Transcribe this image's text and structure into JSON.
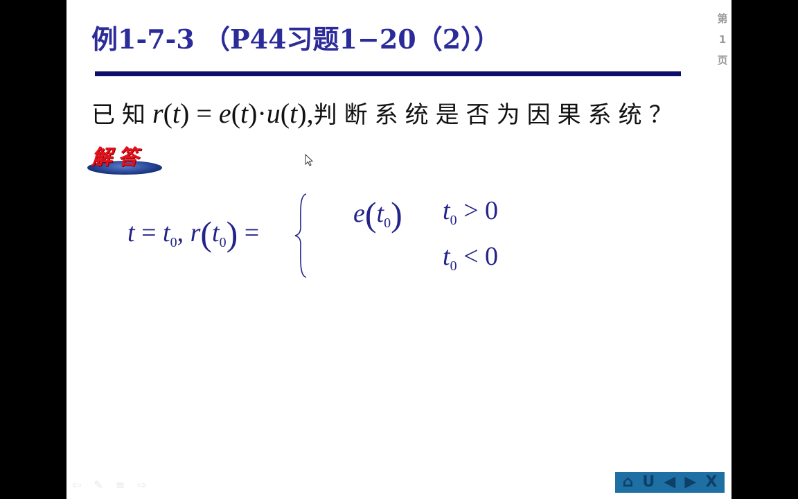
{
  "slide": {
    "title": "例1-7-3 （P44习题1−20（2））",
    "page_indicator": [
      "第",
      "1",
      "页"
    ],
    "question": {
      "prefix": "已知",
      "formula_parts": [
        "r",
        "(",
        "t",
        ")",
        " = ",
        "e",
        "(",
        "t",
        ")",
        "·",
        "u",
        "(",
        "t",
        ")",
        ","
      ],
      "suffix": "判断系统是否为因果系统？"
    },
    "answer_badge": "解答",
    "equation": {
      "lhs": {
        "t": "t",
        "eq1": " = ",
        "t0": "t",
        "sub0": "0",
        "comma": ", ",
        "r": "r",
        "lparen": "(",
        "t0b": "t",
        "sub0b": "0",
        "rparen": ")",
        "eq2": " ="
      },
      "cases": [
        {
          "value_fn": "e",
          "value_arg": "t",
          "value_sub": "0",
          "cond_var": "t",
          "cond_sub": "0",
          "cond_op": " > ",
          "cond_rhs": "0"
        },
        {
          "value_fn": "",
          "value_arg": "",
          "value_sub": "",
          "cond_var": "t",
          "cond_sub": "0",
          "cond_op": " < ",
          "cond_rhs": "0"
        }
      ]
    }
  },
  "nav": {
    "home": "⌂",
    "return": "U",
    "prev": "◀",
    "next": "▶",
    "close": "X"
  },
  "ghost_tools": [
    "⇦",
    "✎",
    "≡",
    "⇨"
  ],
  "colors": {
    "title": "#2b2b9a",
    "divider": "#0d0d6b",
    "equation": "#23238a",
    "nav_bg": "#1e6fa3",
    "answer_red": "#e8101a"
  }
}
